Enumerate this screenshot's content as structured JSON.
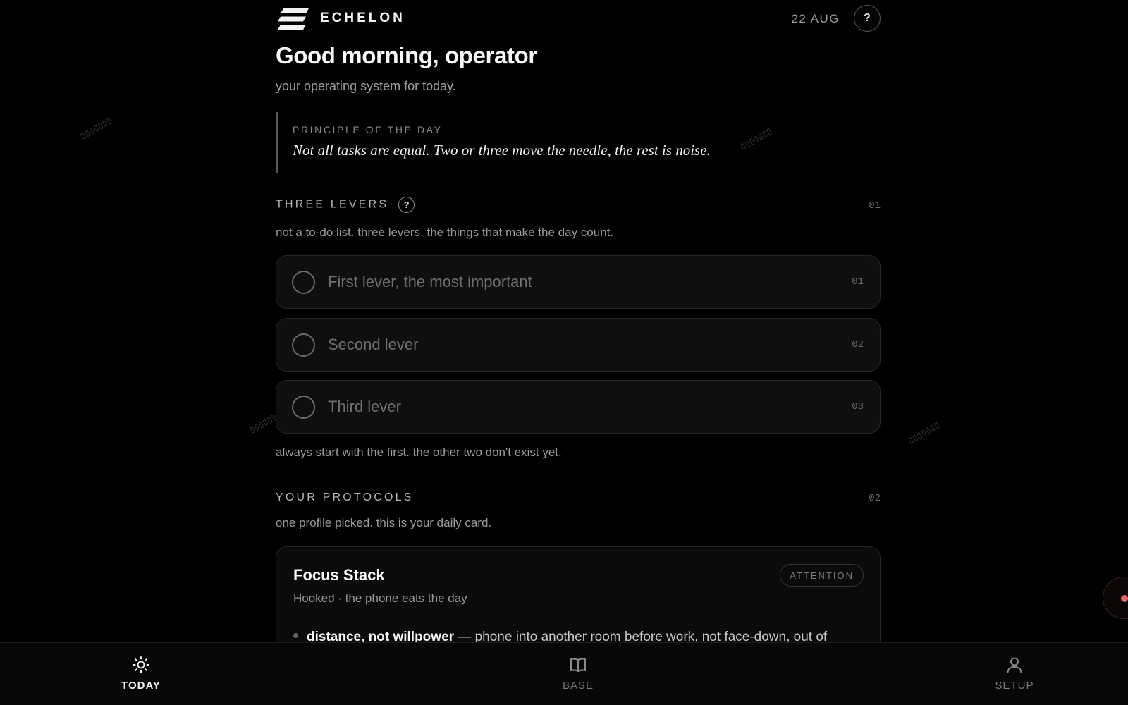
{
  "app": {
    "brand": "ECHELON",
    "date": "22 AUG",
    "help_label": "?"
  },
  "hero": {
    "greeting": "Good morning, operator",
    "subtitle": "your operating system for today."
  },
  "principle": {
    "label": "PRINCIPLE OF THE DAY",
    "text": "Not all tasks are equal. Two or three move the needle, the rest is noise."
  },
  "levers_section": {
    "title": "THREE LEVERS",
    "help": "?",
    "number": "01",
    "description": "not a to-do list. three levers, the things that make the day count.",
    "items": [
      {
        "placeholder": "First lever, the most important",
        "value": "",
        "number": "01"
      },
      {
        "placeholder": "Second lever",
        "value": "",
        "number": "02"
      },
      {
        "placeholder": "Third lever",
        "value": "",
        "number": "03"
      }
    ],
    "footer": "always start with the first. the other two don't exist yet."
  },
  "protocols_section": {
    "title": "YOUR PROTOCOLS",
    "number": "02",
    "description": "one profile picked. this is your daily card.",
    "card": {
      "title": "Focus Stack",
      "badge": "ATTENTION",
      "subtitle": "Hooked · the phone eats the day",
      "bullet_bold": "distance, not willpower",
      "bullet_rest": " — phone into another room before work, not face-down, out of"
    }
  },
  "bottom_nav": {
    "items": [
      {
        "label": "TODAY",
        "icon": "sun-icon",
        "active": true
      },
      {
        "label": "BASE",
        "icon": "book-icon",
        "active": false
      },
      {
        "label": "SETUP",
        "icon": "user-icon",
        "active": false
      }
    ]
  },
  "colors": {
    "background": "#000000",
    "accent_record": "#e2656b",
    "card": "#0f0f0f"
  },
  "decorations": {
    "glyphs": "▯▯▯▯▯▯▯"
  }
}
